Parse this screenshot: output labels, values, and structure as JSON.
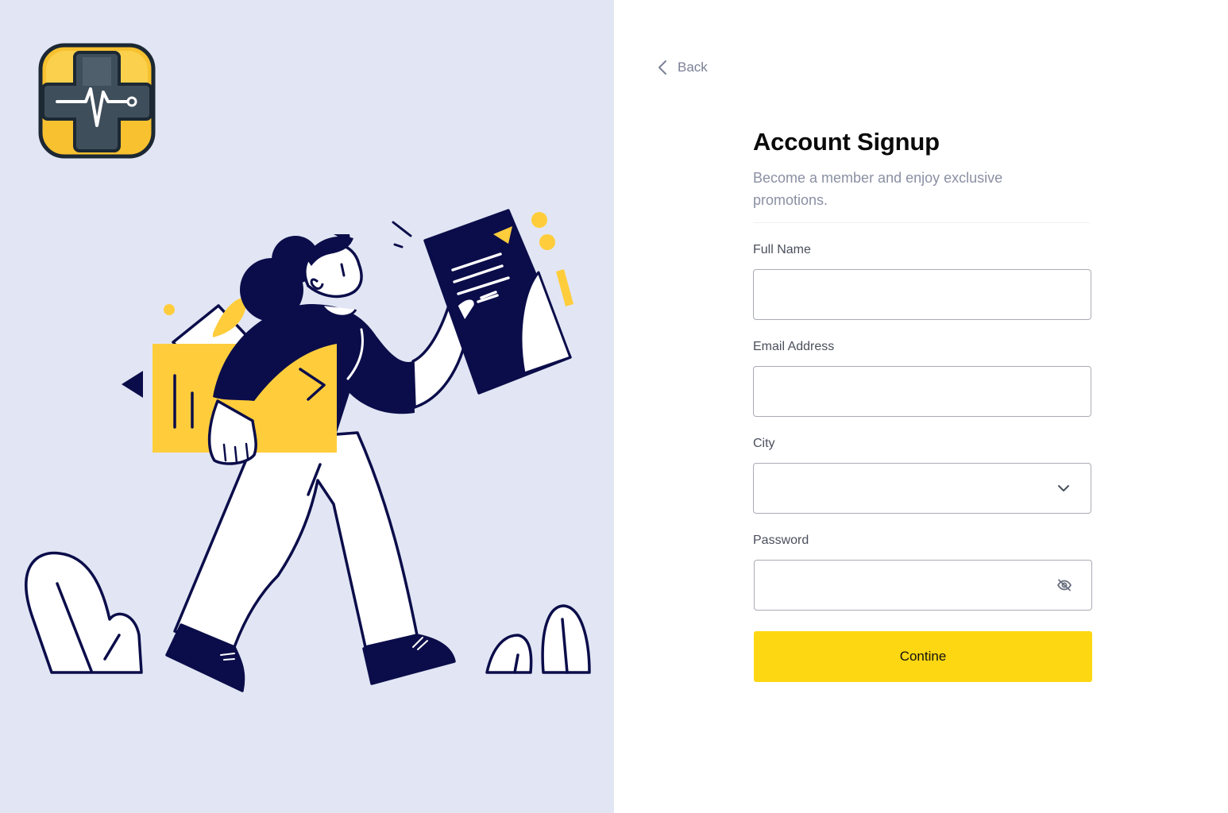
{
  "brand": {
    "logo_icon": "medical-cross-heartbeat-icon",
    "logo_color": "#f7c12f",
    "cross_color": "#3f4e5b",
    "panel_background": "#e2e6f4"
  },
  "illustration": {
    "name": "woman-walking-with-document-illustration",
    "primary_color": "#0b0d4a",
    "accent_color": "#ffcd3c"
  },
  "navigation": {
    "back_label": "Back",
    "back_icon": "chevron-left-icon"
  },
  "form": {
    "title": "Account Signup",
    "subtitle": "Become a member and enjoy exclusive promotions.",
    "fields": {
      "full_name": {
        "label": "Full Name",
        "value": "",
        "placeholder": ""
      },
      "email": {
        "label": "Email Address",
        "value": "",
        "placeholder": ""
      },
      "city": {
        "label": "City",
        "value": "",
        "placeholder": "",
        "icon": "chevron-down-icon"
      },
      "password": {
        "label": "Password",
        "value": "",
        "placeholder": "",
        "icon": "eye-off-icon"
      }
    },
    "submit_label": "Contine",
    "submit_color": "#fdd712"
  }
}
